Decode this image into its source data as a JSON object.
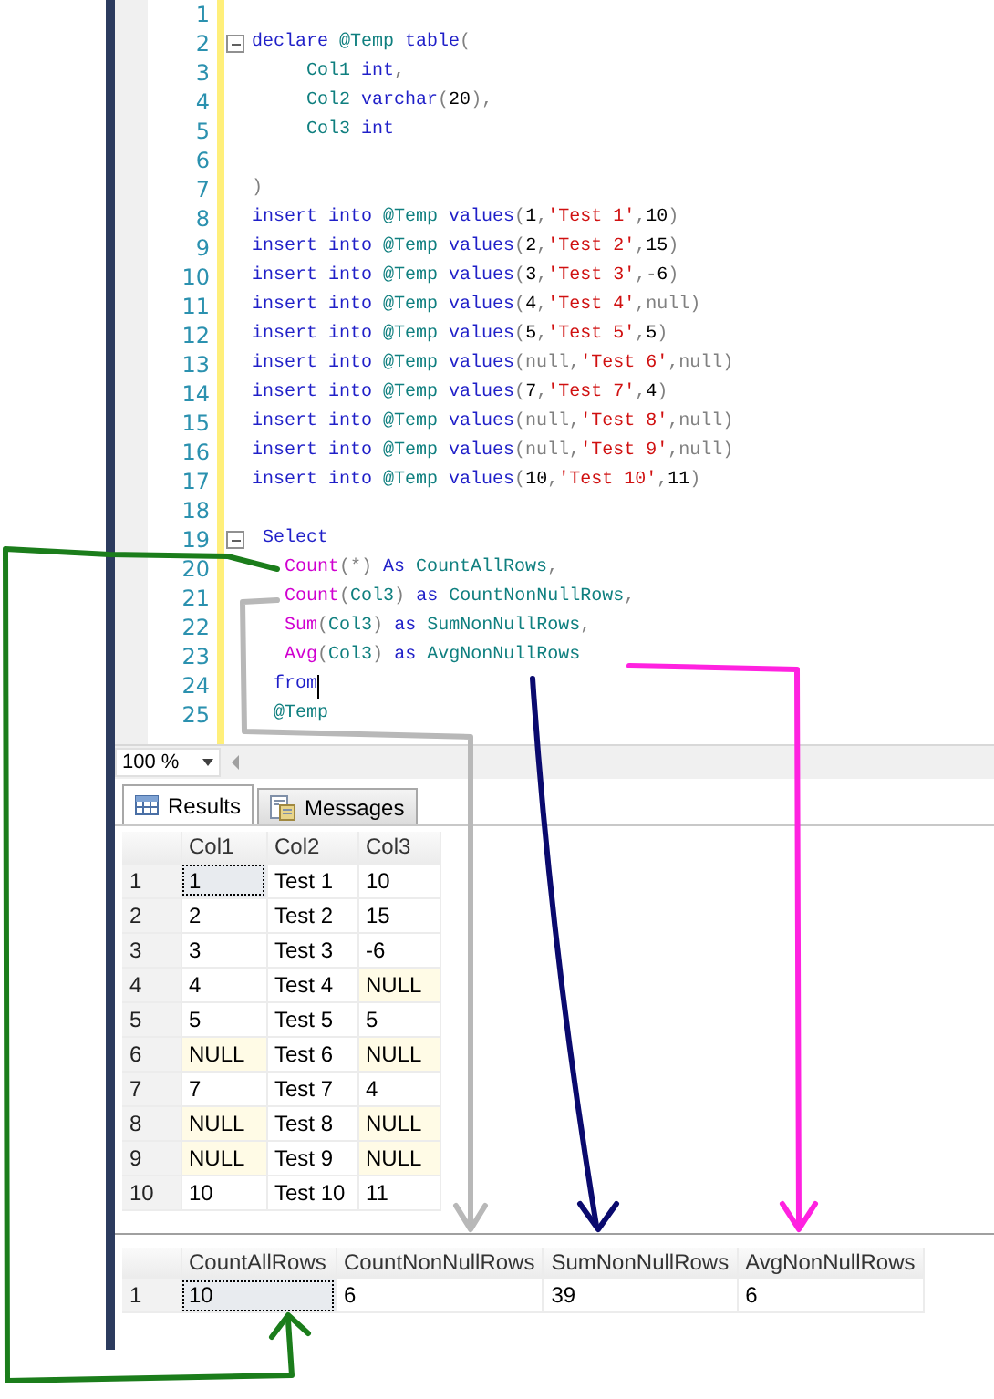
{
  "editor": {
    "lines": [
      {
        "number": "1",
        "fold": false,
        "cursor": false
      },
      {
        "number": "2",
        "fold": true,
        "cursor": false,
        "tokens": [
          {
            "kind": "kw",
            "text": "declare "
          },
          {
            "kind": "id",
            "text": "@Temp "
          },
          {
            "kind": "kw",
            "text": "table"
          },
          {
            "kind": "op",
            "text": "("
          }
        ]
      },
      {
        "number": "3",
        "fold": false,
        "cursor": false,
        "tokens": [
          {
            "kind": "id",
            "text": "     Col1 "
          },
          {
            "kind": "kw",
            "text": "int"
          },
          {
            "kind": "op",
            "text": ","
          }
        ]
      },
      {
        "number": "4",
        "fold": false,
        "cursor": false,
        "tokens": [
          {
            "kind": "id",
            "text": "     Col2 "
          },
          {
            "kind": "kw",
            "text": "varchar"
          },
          {
            "kind": "op",
            "text": "("
          },
          {
            "kind": "num",
            "text": "20"
          },
          {
            "kind": "op",
            "text": "),"
          }
        ]
      },
      {
        "number": "5",
        "fold": false,
        "cursor": false,
        "tokens": [
          {
            "kind": "id",
            "text": "     Col3 "
          },
          {
            "kind": "kw",
            "text": "int"
          }
        ]
      },
      {
        "number": "6",
        "fold": false,
        "cursor": false
      },
      {
        "number": "7",
        "fold": false,
        "cursor": false,
        "tokens": [
          {
            "kind": "op",
            "text": ")"
          }
        ]
      },
      {
        "number": "8",
        "fold": false,
        "cursor": false,
        "tokens": [
          {
            "kind": "kw",
            "text": "insert into "
          },
          {
            "kind": "id",
            "text": "@Temp "
          },
          {
            "kind": "kw",
            "text": "values"
          },
          {
            "kind": "op",
            "text": "("
          },
          {
            "kind": "num",
            "text": "1"
          },
          {
            "kind": "op",
            "text": ","
          },
          {
            "kind": "str",
            "text": "'Test 1'"
          },
          {
            "kind": "op",
            "text": ","
          },
          {
            "kind": "num",
            "text": "10"
          },
          {
            "kind": "op",
            "text": ")"
          }
        ]
      },
      {
        "number": "9",
        "fold": false,
        "cursor": false,
        "tokens": [
          {
            "kind": "kw",
            "text": "insert into "
          },
          {
            "kind": "id",
            "text": "@Temp "
          },
          {
            "kind": "kw",
            "text": "values"
          },
          {
            "kind": "op",
            "text": "("
          },
          {
            "kind": "num",
            "text": "2"
          },
          {
            "kind": "op",
            "text": ","
          },
          {
            "kind": "str",
            "text": "'Test 2'"
          },
          {
            "kind": "op",
            "text": ","
          },
          {
            "kind": "num",
            "text": "15"
          },
          {
            "kind": "op",
            "text": ")"
          }
        ]
      },
      {
        "number": "10",
        "fold": false,
        "cursor": false,
        "tokens": [
          {
            "kind": "kw",
            "text": "insert into "
          },
          {
            "kind": "id",
            "text": "@Temp "
          },
          {
            "kind": "kw",
            "text": "values"
          },
          {
            "kind": "op",
            "text": "("
          },
          {
            "kind": "num",
            "text": "3"
          },
          {
            "kind": "op",
            "text": ","
          },
          {
            "kind": "str",
            "text": "'Test 3'"
          },
          {
            "kind": "op",
            "text": ",-"
          },
          {
            "kind": "num",
            "text": "6"
          },
          {
            "kind": "op",
            "text": ")"
          }
        ]
      },
      {
        "number": "11",
        "fold": false,
        "cursor": false,
        "tokens": [
          {
            "kind": "kw",
            "text": "insert into "
          },
          {
            "kind": "id",
            "text": "@Temp "
          },
          {
            "kind": "kw",
            "text": "values"
          },
          {
            "kind": "op",
            "text": "("
          },
          {
            "kind": "num",
            "text": "4"
          },
          {
            "kind": "op",
            "text": ","
          },
          {
            "kind": "str",
            "text": "'Test 4'"
          },
          {
            "kind": "op",
            "text": ",null)"
          }
        ]
      },
      {
        "number": "12",
        "fold": false,
        "cursor": false,
        "tokens": [
          {
            "kind": "kw",
            "text": "insert into "
          },
          {
            "kind": "id",
            "text": "@Temp "
          },
          {
            "kind": "kw",
            "text": "values"
          },
          {
            "kind": "op",
            "text": "("
          },
          {
            "kind": "num",
            "text": "5"
          },
          {
            "kind": "op",
            "text": ","
          },
          {
            "kind": "str",
            "text": "'Test 5'"
          },
          {
            "kind": "op",
            "text": ","
          },
          {
            "kind": "num",
            "text": "5"
          },
          {
            "kind": "op",
            "text": ")"
          }
        ]
      },
      {
        "number": "13",
        "fold": false,
        "cursor": false,
        "tokens": [
          {
            "kind": "kw",
            "text": "insert into "
          },
          {
            "kind": "id",
            "text": "@Temp "
          },
          {
            "kind": "kw",
            "text": "values"
          },
          {
            "kind": "op",
            "text": "(null,"
          },
          {
            "kind": "str",
            "text": "'Test 6'"
          },
          {
            "kind": "op",
            "text": ",null)"
          }
        ]
      },
      {
        "number": "14",
        "fold": false,
        "cursor": false,
        "tokens": [
          {
            "kind": "kw",
            "text": "insert into "
          },
          {
            "kind": "id",
            "text": "@Temp "
          },
          {
            "kind": "kw",
            "text": "values"
          },
          {
            "kind": "op",
            "text": "("
          },
          {
            "kind": "num",
            "text": "7"
          },
          {
            "kind": "op",
            "text": ","
          },
          {
            "kind": "str",
            "text": "'Test 7'"
          },
          {
            "kind": "op",
            "text": ","
          },
          {
            "kind": "num",
            "text": "4"
          },
          {
            "kind": "op",
            "text": ")"
          }
        ]
      },
      {
        "number": "15",
        "fold": false,
        "cursor": false,
        "tokens": [
          {
            "kind": "kw",
            "text": "insert into "
          },
          {
            "kind": "id",
            "text": "@Temp "
          },
          {
            "kind": "kw",
            "text": "values"
          },
          {
            "kind": "op",
            "text": "(null,"
          },
          {
            "kind": "str",
            "text": "'Test 8'"
          },
          {
            "kind": "op",
            "text": ",null)"
          }
        ]
      },
      {
        "number": "16",
        "fold": false,
        "cursor": false,
        "tokens": [
          {
            "kind": "kw",
            "text": "insert into "
          },
          {
            "kind": "id",
            "text": "@Temp "
          },
          {
            "kind": "kw",
            "text": "values"
          },
          {
            "kind": "op",
            "text": "(null,"
          },
          {
            "kind": "str",
            "text": "'Test 9'"
          },
          {
            "kind": "op",
            "text": ",null)"
          }
        ]
      },
      {
        "number": "17",
        "fold": false,
        "cursor": false,
        "tokens": [
          {
            "kind": "kw",
            "text": "insert into "
          },
          {
            "kind": "id",
            "text": "@Temp "
          },
          {
            "kind": "kw",
            "text": "values"
          },
          {
            "kind": "op",
            "text": "("
          },
          {
            "kind": "num",
            "text": "10"
          },
          {
            "kind": "op",
            "text": ","
          },
          {
            "kind": "str",
            "text": "'Test 10'"
          },
          {
            "kind": "op",
            "text": ","
          },
          {
            "kind": "num",
            "text": "11"
          },
          {
            "kind": "op",
            "text": ")"
          }
        ]
      },
      {
        "number": "18",
        "fold": false,
        "cursor": false
      },
      {
        "number": "19",
        "fold": true,
        "cursor": false,
        "tokens": [
          {
            "kind": "kw",
            "text": " Select"
          }
        ]
      },
      {
        "number": "20",
        "fold": false,
        "cursor": false,
        "tokens": [
          {
            "kind": "fn",
            "text": "   Count"
          },
          {
            "kind": "op",
            "text": "(*)"
          },
          {
            "kind": "kw",
            "text": " As "
          },
          {
            "kind": "id",
            "text": "CountAllRows"
          },
          {
            "kind": "op",
            "text": ","
          }
        ]
      },
      {
        "number": "21",
        "fold": false,
        "cursor": false,
        "tokens": [
          {
            "kind": "fn",
            "text": "   Count"
          },
          {
            "kind": "op",
            "text": "("
          },
          {
            "kind": "id",
            "text": "Col3"
          },
          {
            "kind": "op",
            "text": ")"
          },
          {
            "kind": "kw",
            "text": " as "
          },
          {
            "kind": "id",
            "text": "CountNonNullRows"
          },
          {
            "kind": "op",
            "text": ","
          }
        ]
      },
      {
        "number": "22",
        "fold": false,
        "cursor": false,
        "tokens": [
          {
            "kind": "fn",
            "text": "   Sum"
          },
          {
            "kind": "op",
            "text": "("
          },
          {
            "kind": "id",
            "text": "Col3"
          },
          {
            "kind": "op",
            "text": ")"
          },
          {
            "kind": "kw",
            "text": " as "
          },
          {
            "kind": "id",
            "text": "SumNonNullRows"
          },
          {
            "kind": "op",
            "text": ","
          }
        ]
      },
      {
        "number": "23",
        "fold": false,
        "cursor": false,
        "tokens": [
          {
            "kind": "fn",
            "text": "   Avg"
          },
          {
            "kind": "op",
            "text": "("
          },
          {
            "kind": "id",
            "text": "Col3"
          },
          {
            "kind": "op",
            "text": ")"
          },
          {
            "kind": "kw",
            "text": " as "
          },
          {
            "kind": "id",
            "text": "AvgNonNullRows"
          }
        ]
      },
      {
        "number": "24",
        "fold": false,
        "cursor": true,
        "tokens": [
          {
            "kind": "kw",
            "text": "  from"
          }
        ]
      },
      {
        "number": "25",
        "fold": false,
        "cursor": false,
        "tokens": [
          {
            "kind": "id",
            "text": "  @Temp"
          }
        ]
      }
    ]
  },
  "zoom": {
    "value": "100 %"
  },
  "tabs": [
    {
      "label": "Results",
      "kind": "grid",
      "selected": true
    },
    {
      "label": "Messages",
      "kind": "messages",
      "selected": false
    }
  ],
  "grids": [
    {
      "columns": [
        "Col1",
        "Col2",
        "Col3"
      ],
      "rows": [
        {
          "number": "1",
          "cells": [
            {
              "text": "1",
              "is_null": false,
              "selected": true
            },
            {
              "text": "Test 1",
              "is_null": false,
              "selected": false
            },
            {
              "text": "10",
              "is_null": false,
              "selected": false
            }
          ]
        },
        {
          "number": "2",
          "cells": [
            {
              "text": "2",
              "is_null": false,
              "selected": false
            },
            {
              "text": "Test 2",
              "is_null": false,
              "selected": false
            },
            {
              "text": "15",
              "is_null": false,
              "selected": false
            }
          ]
        },
        {
          "number": "3",
          "cells": [
            {
              "text": "3",
              "is_null": false,
              "selected": false
            },
            {
              "text": "Test 3",
              "is_null": false,
              "selected": false
            },
            {
              "text": "-6",
              "is_null": false,
              "selected": false
            }
          ]
        },
        {
          "number": "4",
          "cells": [
            {
              "text": "4",
              "is_null": false,
              "selected": false
            },
            {
              "text": "Test 4",
              "is_null": false,
              "selected": false
            },
            {
              "text": "NULL",
              "is_null": true,
              "selected": false
            }
          ]
        },
        {
          "number": "5",
          "cells": [
            {
              "text": "5",
              "is_null": false,
              "selected": false
            },
            {
              "text": "Test 5",
              "is_null": false,
              "selected": false
            },
            {
              "text": "5",
              "is_null": false,
              "selected": false
            }
          ]
        },
        {
          "number": "6",
          "cells": [
            {
              "text": "NULL",
              "is_null": true,
              "selected": false
            },
            {
              "text": "Test 6",
              "is_null": false,
              "selected": false
            },
            {
              "text": "NULL",
              "is_null": true,
              "selected": false
            }
          ]
        },
        {
          "number": "7",
          "cells": [
            {
              "text": "7",
              "is_null": false,
              "selected": false
            },
            {
              "text": "Test 7",
              "is_null": false,
              "selected": false
            },
            {
              "text": "4",
              "is_null": false,
              "selected": false
            }
          ]
        },
        {
          "number": "8",
          "cells": [
            {
              "text": "NULL",
              "is_null": true,
              "selected": false
            },
            {
              "text": "Test 8",
              "is_null": false,
              "selected": false
            },
            {
              "text": "NULL",
              "is_null": true,
              "selected": false
            }
          ]
        },
        {
          "number": "9",
          "cells": [
            {
              "text": "NULL",
              "is_null": true,
              "selected": false
            },
            {
              "text": "Test 9",
              "is_null": false,
              "selected": false
            },
            {
              "text": "NULL",
              "is_null": true,
              "selected": false
            }
          ]
        },
        {
          "number": "10",
          "cells": [
            {
              "text": "10",
              "is_null": false,
              "selected": false
            },
            {
              "text": "Test 10",
              "is_null": false,
              "selected": false
            },
            {
              "text": "11",
              "is_null": false,
              "selected": false
            }
          ]
        }
      ]
    },
    {
      "columns": [
        "CountAllRows",
        "CountNonNullRows",
        "SumNonNullRows",
        "AvgNonNullRows"
      ],
      "rows": [
        {
          "number": "1",
          "cells": [
            {
              "text": "10",
              "is_null": false,
              "selected": true
            },
            {
              "text": "6",
              "is_null": false,
              "selected": false
            },
            {
              "text": "39",
              "is_null": false,
              "selected": false
            },
            {
              "text": "6",
              "is_null": false,
              "selected": false
            }
          ]
        }
      ]
    }
  ],
  "annotations": [
    {
      "kind": "arrow",
      "color": "#1b7d1b"
    },
    {
      "kind": "arrow",
      "color": "#b8b8b8"
    },
    {
      "kind": "arrow",
      "color": "#0a0a6e"
    },
    {
      "kind": "arrow",
      "color": "#ff22e0"
    }
  ]
}
